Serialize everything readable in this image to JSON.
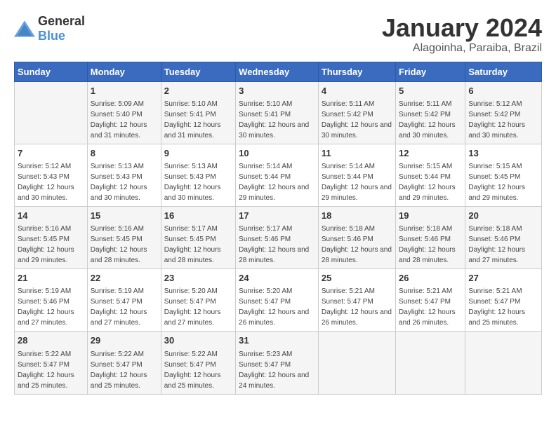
{
  "header": {
    "logo_general": "General",
    "logo_blue": "Blue",
    "month": "January 2024",
    "location": "Alagoinha, Paraiba, Brazil"
  },
  "columns": [
    "Sunday",
    "Monday",
    "Tuesday",
    "Wednesday",
    "Thursday",
    "Friday",
    "Saturday"
  ],
  "rows": [
    [
      {
        "day": "",
        "sunrise": "",
        "sunset": "",
        "daylight": ""
      },
      {
        "day": "1",
        "sunrise": "Sunrise: 5:09 AM",
        "sunset": "Sunset: 5:40 PM",
        "daylight": "Daylight: 12 hours and 31 minutes."
      },
      {
        "day": "2",
        "sunrise": "Sunrise: 5:10 AM",
        "sunset": "Sunset: 5:41 PM",
        "daylight": "Daylight: 12 hours and 31 minutes."
      },
      {
        "day": "3",
        "sunrise": "Sunrise: 5:10 AM",
        "sunset": "Sunset: 5:41 PM",
        "daylight": "Daylight: 12 hours and 30 minutes."
      },
      {
        "day": "4",
        "sunrise": "Sunrise: 5:11 AM",
        "sunset": "Sunset: 5:42 PM",
        "daylight": "Daylight: 12 hours and 30 minutes."
      },
      {
        "day": "5",
        "sunrise": "Sunrise: 5:11 AM",
        "sunset": "Sunset: 5:42 PM",
        "daylight": "Daylight: 12 hours and 30 minutes."
      },
      {
        "day": "6",
        "sunrise": "Sunrise: 5:12 AM",
        "sunset": "Sunset: 5:42 PM",
        "daylight": "Daylight: 12 hours and 30 minutes."
      }
    ],
    [
      {
        "day": "7",
        "sunrise": "Sunrise: 5:12 AM",
        "sunset": "Sunset: 5:43 PM",
        "daylight": "Daylight: 12 hours and 30 minutes."
      },
      {
        "day": "8",
        "sunrise": "Sunrise: 5:13 AM",
        "sunset": "Sunset: 5:43 PM",
        "daylight": "Daylight: 12 hours and 30 minutes."
      },
      {
        "day": "9",
        "sunrise": "Sunrise: 5:13 AM",
        "sunset": "Sunset: 5:43 PM",
        "daylight": "Daylight: 12 hours and 30 minutes."
      },
      {
        "day": "10",
        "sunrise": "Sunrise: 5:14 AM",
        "sunset": "Sunset: 5:44 PM",
        "daylight": "Daylight: 12 hours and 29 minutes."
      },
      {
        "day": "11",
        "sunrise": "Sunrise: 5:14 AM",
        "sunset": "Sunset: 5:44 PM",
        "daylight": "Daylight: 12 hours and 29 minutes."
      },
      {
        "day": "12",
        "sunrise": "Sunrise: 5:15 AM",
        "sunset": "Sunset: 5:44 PM",
        "daylight": "Daylight: 12 hours and 29 minutes."
      },
      {
        "day": "13",
        "sunrise": "Sunrise: 5:15 AM",
        "sunset": "Sunset: 5:45 PM",
        "daylight": "Daylight: 12 hours and 29 minutes."
      }
    ],
    [
      {
        "day": "14",
        "sunrise": "Sunrise: 5:16 AM",
        "sunset": "Sunset: 5:45 PM",
        "daylight": "Daylight: 12 hours and 29 minutes."
      },
      {
        "day": "15",
        "sunrise": "Sunrise: 5:16 AM",
        "sunset": "Sunset: 5:45 PM",
        "daylight": "Daylight: 12 hours and 28 minutes."
      },
      {
        "day": "16",
        "sunrise": "Sunrise: 5:17 AM",
        "sunset": "Sunset: 5:45 PM",
        "daylight": "Daylight: 12 hours and 28 minutes."
      },
      {
        "day": "17",
        "sunrise": "Sunrise: 5:17 AM",
        "sunset": "Sunset: 5:46 PM",
        "daylight": "Daylight: 12 hours and 28 minutes."
      },
      {
        "day": "18",
        "sunrise": "Sunrise: 5:18 AM",
        "sunset": "Sunset: 5:46 PM",
        "daylight": "Daylight: 12 hours and 28 minutes."
      },
      {
        "day": "19",
        "sunrise": "Sunrise: 5:18 AM",
        "sunset": "Sunset: 5:46 PM",
        "daylight": "Daylight: 12 hours and 28 minutes."
      },
      {
        "day": "20",
        "sunrise": "Sunrise: 5:18 AM",
        "sunset": "Sunset: 5:46 PM",
        "daylight": "Daylight: 12 hours and 27 minutes."
      }
    ],
    [
      {
        "day": "21",
        "sunrise": "Sunrise: 5:19 AM",
        "sunset": "Sunset: 5:46 PM",
        "daylight": "Daylight: 12 hours and 27 minutes."
      },
      {
        "day": "22",
        "sunrise": "Sunrise: 5:19 AM",
        "sunset": "Sunset: 5:47 PM",
        "daylight": "Daylight: 12 hours and 27 minutes."
      },
      {
        "day": "23",
        "sunrise": "Sunrise: 5:20 AM",
        "sunset": "Sunset: 5:47 PM",
        "daylight": "Daylight: 12 hours and 27 minutes."
      },
      {
        "day": "24",
        "sunrise": "Sunrise: 5:20 AM",
        "sunset": "Sunset: 5:47 PM",
        "daylight": "Daylight: 12 hours and 26 minutes."
      },
      {
        "day": "25",
        "sunrise": "Sunrise: 5:21 AM",
        "sunset": "Sunset: 5:47 PM",
        "daylight": "Daylight: 12 hours and 26 minutes."
      },
      {
        "day": "26",
        "sunrise": "Sunrise: 5:21 AM",
        "sunset": "Sunset: 5:47 PM",
        "daylight": "Daylight: 12 hours and 26 minutes."
      },
      {
        "day": "27",
        "sunrise": "Sunrise: 5:21 AM",
        "sunset": "Sunset: 5:47 PM",
        "daylight": "Daylight: 12 hours and 25 minutes."
      }
    ],
    [
      {
        "day": "28",
        "sunrise": "Sunrise: 5:22 AM",
        "sunset": "Sunset: 5:47 PM",
        "daylight": "Daylight: 12 hours and 25 minutes."
      },
      {
        "day": "29",
        "sunrise": "Sunrise: 5:22 AM",
        "sunset": "Sunset: 5:47 PM",
        "daylight": "Daylight: 12 hours and 25 minutes."
      },
      {
        "day": "30",
        "sunrise": "Sunrise: 5:22 AM",
        "sunset": "Sunset: 5:47 PM",
        "daylight": "Daylight: 12 hours and 25 minutes."
      },
      {
        "day": "31",
        "sunrise": "Sunrise: 5:23 AM",
        "sunset": "Sunset: 5:47 PM",
        "daylight": "Daylight: 12 hours and 24 minutes."
      },
      {
        "day": "",
        "sunrise": "",
        "sunset": "",
        "daylight": ""
      },
      {
        "day": "",
        "sunrise": "",
        "sunset": "",
        "daylight": ""
      },
      {
        "day": "",
        "sunrise": "",
        "sunset": "",
        "daylight": ""
      }
    ]
  ]
}
